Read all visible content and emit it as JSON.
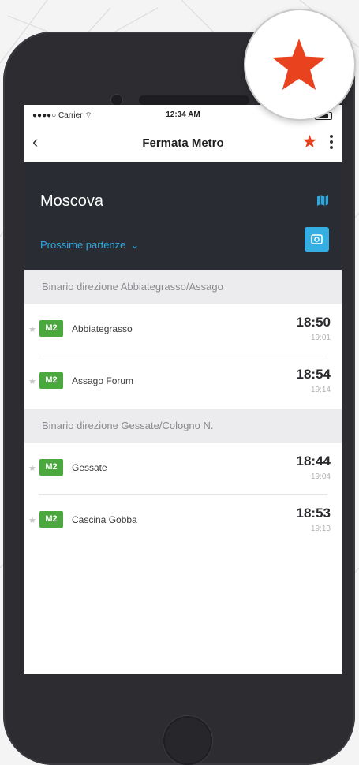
{
  "status_bar": {
    "carrier": "●●●●○ Carrier ⌔",
    "time": "12:34 AM"
  },
  "nav": {
    "back_icon": "chevron-left-icon",
    "title": "Fermata Metro",
    "favorite_icon": "star-icon",
    "favorite_color": "#e8421f",
    "more_icon": "more-vertical-icon"
  },
  "header": {
    "station": "Moscova",
    "map_icon": "map-icon",
    "departures_label": "Prossime partenze",
    "departures_chevron": "⌄",
    "camera_icon": "camera-icon",
    "accent_color": "#2ba9e0"
  },
  "sections": [
    {
      "title": "Binario direzione Abbiategrasso/Assago",
      "rows": [
        {
          "line": "M2",
          "destination": "Abbiategrasso",
          "time": "18:50",
          "next": "19:01"
        },
        {
          "line": "M2",
          "destination": "Assago Forum",
          "time": "18:54",
          "next": "19:14"
        }
      ]
    },
    {
      "title": "Binario direzione Gessate/Cologno N.",
      "rows": [
        {
          "line": "M2",
          "destination": "Gessate",
          "time": "18:44",
          "next": "19:04"
        },
        {
          "line": "M2",
          "destination": "Cascina Gobba",
          "time": "18:53",
          "next": "19:13"
        }
      ]
    }
  ],
  "line_color": "#4aa83e"
}
